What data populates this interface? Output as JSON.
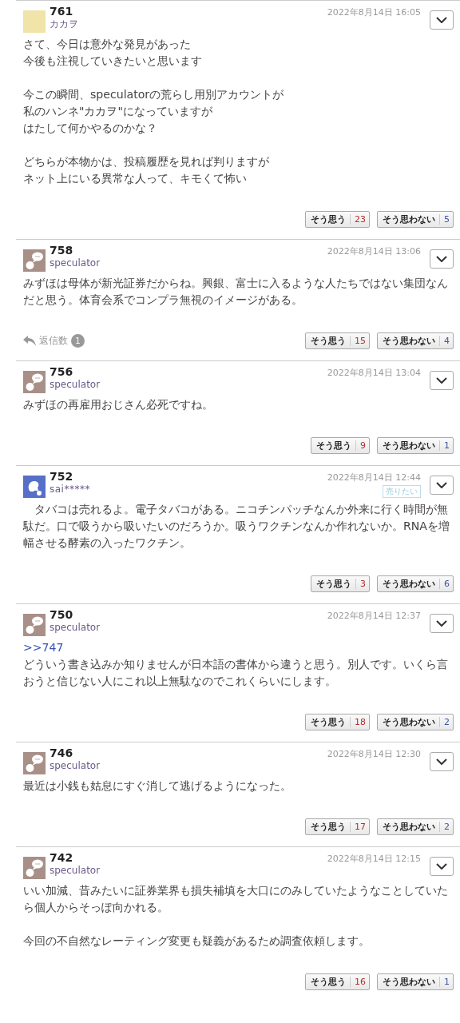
{
  "posts": [
    {
      "number": "761",
      "author": "カカヲ",
      "kind": "photo",
      "date": "2022年8月14日 16:05",
      "paragraphs": [
        [
          "さて、今日は意外な発見があった",
          "今後も注視していきたいと思います"
        ],
        [
          "今この瞬間、speculatorの荒らし用別アカウントが",
          "私のハンネ\"カカヲ\"になっていますが",
          "はたして何かやるのかな？"
        ],
        [
          "どちらが本物かは、投稿履歴を見れば判りますが",
          "ネット上にいる異常な人って、キモくて怖い"
        ]
      ],
      "agree_label": "そう思う",
      "agree": "23",
      "disagree_label": "そう思わない",
      "disagree": "5"
    },
    {
      "number": "758",
      "author": "speculator",
      "kind": "bubble",
      "date": "2022年8月14日 13:06",
      "paragraphs": [
        [
          "みずほは母体が新光証券だからね。興銀、富士に入るような人たちではない集団なんだと思う。体育会系でコンプラ無視のイメージがある。"
        ]
      ],
      "replies_label": "返信数",
      "replies": "1",
      "agree_label": "そう思う",
      "agree": "15",
      "disagree_label": "そう思わない",
      "disagree": "4"
    },
    {
      "number": "756",
      "author": "speculator",
      "kind": "bubble",
      "date": "2022年8月14日 13:04",
      "paragraphs": [
        [
          "みずほの再雇用おじさん必死ですね。"
        ]
      ],
      "agree_label": "そう思う",
      "agree": "9",
      "disagree_label": "そう思わない",
      "disagree": "1"
    },
    {
      "number": "752",
      "author": "sai*****",
      "kind": "person",
      "date": "2022年8月14日 12:44",
      "badge": "売りたい",
      "paragraphs": [
        [
          "　タバコは売れるよ。電子タバコがある。ニコチンパッチなんか外来に行く時間が無駄だ。口で吸うから吸いたいのだろうか。吸うワクチンなんか作れないか。RNAを増幅させる酵素の入ったワクチン。"
        ]
      ],
      "agree_label": "そう思う",
      "agree": "3",
      "disagree_label": "そう思わない",
      "disagree": "6"
    },
    {
      "number": "750",
      "author": "speculator",
      "kind": "bubble",
      "date": "2022年8月14日 12:37",
      "reply_to": ">>747",
      "paragraphs": [
        [
          "どういう書き込みか知りませんが日本語の書体から違うと思う。別人です。いくら言おうと信じない人にこれ以上無駄なのでこれくらいにします。"
        ]
      ],
      "agree_label": "そう思う",
      "agree": "18",
      "disagree_label": "そう思わない",
      "disagree": "2"
    },
    {
      "number": "746",
      "author": "speculator",
      "kind": "bubble",
      "date": "2022年8月14日 12:30",
      "paragraphs": [
        [
          "最近は小銭も姑息にすぐ消して逃げるようになった。"
        ]
      ],
      "agree_label": "そう思う",
      "agree": "17",
      "disagree_label": "そう思わない",
      "disagree": "2"
    },
    {
      "number": "742",
      "author": "speculator",
      "kind": "bubble",
      "date": "2022年8月14日 12:15",
      "paragraphs": [
        [
          "いい加減、昔みたいに証券業界も損失補填を大口にのみしていたようなことしていたら個人からそっぽ向かれる。"
        ],
        [
          "今回の不自然なレーティング変更も疑義があるため調査依頼します。"
        ]
      ],
      "agree_label": "そう思う",
      "agree": "16",
      "disagree_label": "そう思わない",
      "disagree": "1"
    }
  ]
}
